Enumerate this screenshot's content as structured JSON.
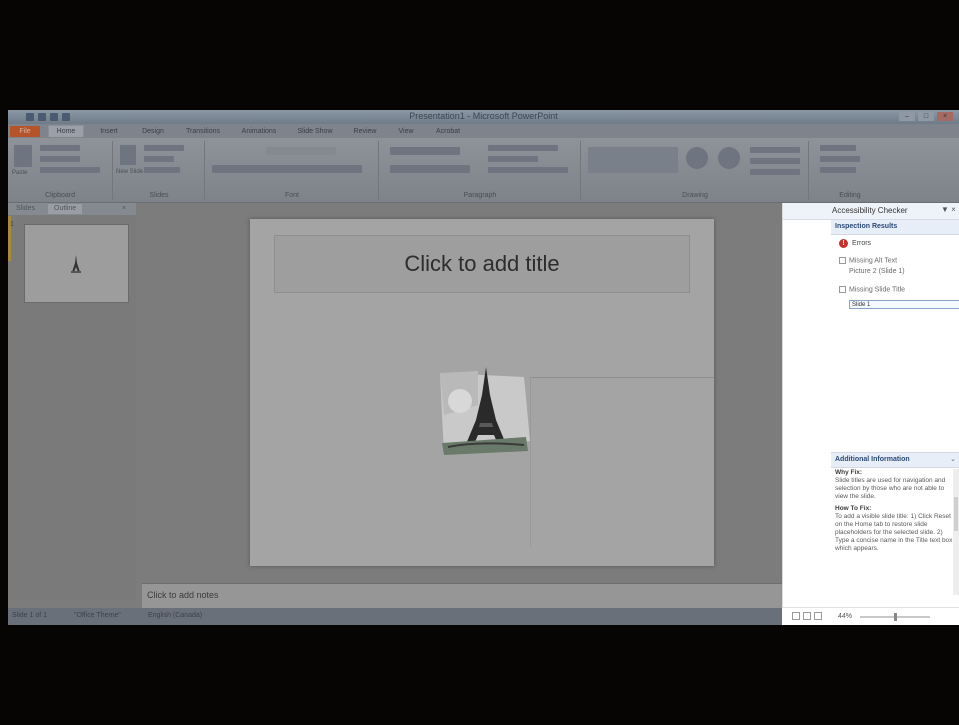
{
  "app": {
    "title": "Presentation1 - Microsoft PowerPoint"
  },
  "ribbon": {
    "tabs": [
      "File",
      "Home",
      "Insert",
      "Design",
      "Transitions",
      "Animations",
      "Slide Show",
      "Review",
      "View",
      "Acrobat"
    ],
    "active_tab": "Home",
    "groups": [
      "Clipboard",
      "Slides",
      "Font",
      "Paragraph",
      "Drawing",
      "Editing"
    ],
    "paste_label": "Paste",
    "new_slide_label": "New Slide"
  },
  "outline_pane": {
    "tabs": [
      "Slides",
      "Outline"
    ],
    "slide_number": "1"
  },
  "slide": {
    "title_placeholder": "Click to add title"
  },
  "notes": {
    "placeholder": "Click to add notes"
  },
  "status_bar": {
    "slide_info": "Slide 1 of 1",
    "theme": "\"Office Theme\"",
    "language": "English (Canada)"
  },
  "accessibility_pane": {
    "title": "Accessibility Checker",
    "inspection_results_label": "Inspection Results",
    "errors_label": "Errors",
    "missing_alt_text": "Missing Alt Text",
    "picture_item": "Picture 2  (Slide 1)",
    "missing_slide_title": "Missing Slide Title",
    "slide_item": "Slide 1",
    "additional_info_label": "Additional Information",
    "why_fix_heading": "Why Fix:",
    "why_fix_text": "Slide titles are used for navigation and selection by those who are not able to view the slide.",
    "how_to_fix_heading": "How To Fix:",
    "how_to_fix_text": "To add a visible slide title: 1) Click Reset on the Home tab to restore slide placeholders for the selected slide. 2) Type a concise name in the Title text box which appears."
  },
  "zoom": {
    "value": "44%"
  },
  "colors": {
    "file_tab": "#b5532b",
    "error_icon": "#c7302c",
    "selection_bar": "#a88a3a"
  }
}
